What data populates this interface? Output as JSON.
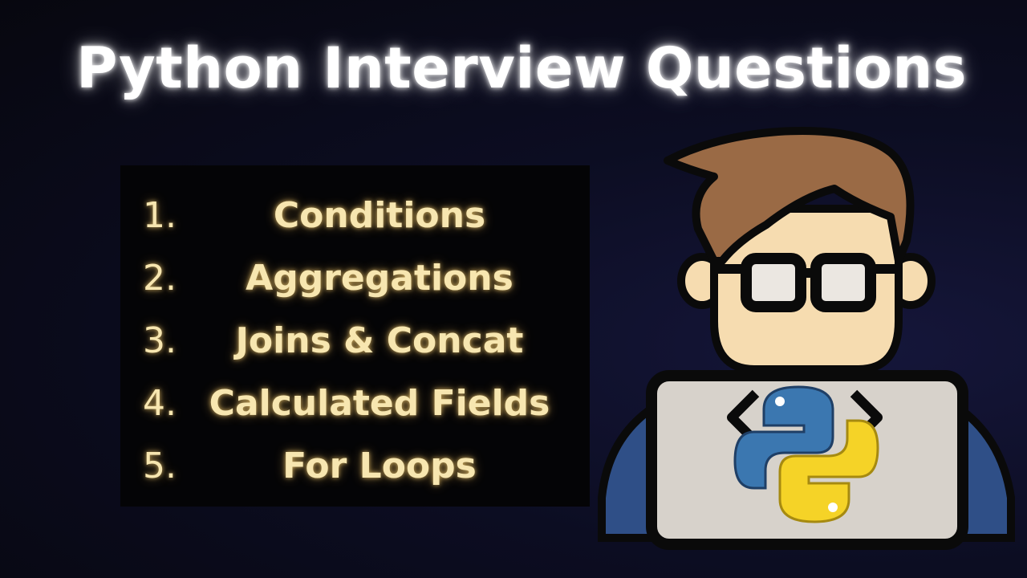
{
  "title": "Python Interview Questions",
  "items": [
    {
      "number": "1.",
      "label": "Conditions"
    },
    {
      "number": "2.",
      "label": "Aggregations"
    },
    {
      "number": "3.",
      "label": "Joins & Concat"
    },
    {
      "number": "4.",
      "label": "Calculated Fields"
    },
    {
      "number": "5.",
      "label": "For Loops"
    }
  ],
  "colors": {
    "title": "#ffffff",
    "list_text": "#f7e6b0",
    "hair": "#9a6a45",
    "skin": "#f6dcb0",
    "shirt": "#2f4f87",
    "laptop": "#d7d2cb",
    "python_blue": "#3b77b0",
    "python_yellow": "#f5d327"
  },
  "icons": [
    "developer-character-illustration",
    "python-logo-icon",
    "code-brackets-icon"
  ]
}
